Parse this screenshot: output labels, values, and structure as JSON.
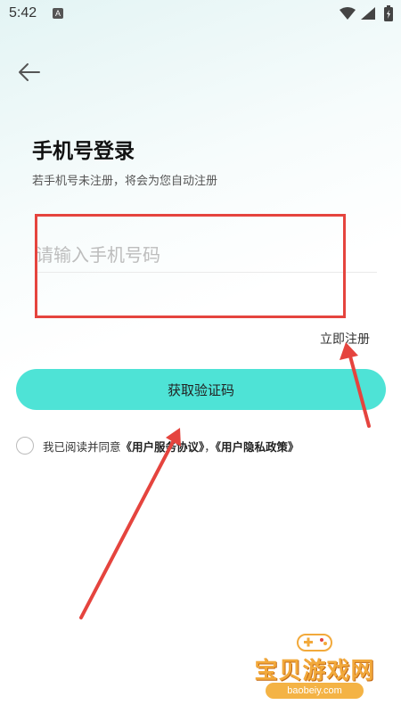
{
  "status_bar": {
    "time": "5:42",
    "notification_glyph": "A",
    "icons": [
      "wifi-icon",
      "signal-icon",
      "battery-icon"
    ]
  },
  "header": {
    "back_icon": "arrow-left-icon"
  },
  "login": {
    "title": "手机号登录",
    "subtitle": "若手机号未注册，将会为您自动注册",
    "phone_input": {
      "value": "",
      "placeholder": "请输入手机号码"
    },
    "register_link": "立即注册",
    "get_code_button": "获取验证码",
    "agreement": {
      "prefix": "我已阅读并同意",
      "service_agreement": "《用户服务协议》",
      "separator": "，",
      "privacy_policy": "《用户隐私政策》",
      "checked": false
    }
  },
  "annotations": {
    "highlight_color": "#e5443e",
    "arrow_color": "#e5443e"
  },
  "watermark": {
    "name": "宝贝游戏网",
    "url": "baobeiy.com"
  },
  "colors": {
    "accent": "#4ee3d6",
    "background_tint": "#e3f4f4"
  }
}
